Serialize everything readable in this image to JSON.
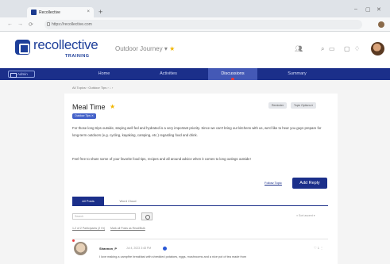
{
  "browser": {
    "tab_title": "Recollective",
    "tab_close": "×",
    "new_tab": "+",
    "url": "https://recollective.com",
    "minimize": "–",
    "maximize": "▢",
    "close": "✕",
    "back": "←",
    "forward": "→",
    "reload": "⟳"
  },
  "header": {
    "logo_text": "recollective",
    "logo_sub": "TRAINING",
    "journey_label": "Outdoor Journey",
    "journey_caret": "▾",
    "journey_star": "★"
  },
  "mainnav": {
    "admin_label": "Admin",
    "items": [
      "Home",
      "Activities",
      "Discussions",
      "Summary"
    ],
    "active_index": 2
  },
  "breadcrumb": "All Topics  ›  Outdoor Tips  ›  ↓  ›",
  "topic": {
    "title": "Meal Time",
    "tag": "Outdoor Tips ✕",
    "reminder_btn": "Reminder",
    "topic_options_btn": "Topic Options ▾",
    "para1": "For those long trips outside, staying well fed and hydrated is a very important priority. Since we can't bring our kitchens with us, we'd like to hear you guys prepare for long-term outdoors (e.g. cycling, kayaking, camping, etc.) regarding food and drink.",
    "para2": "Feel free to share some of your favorite food tips, recipes and all around advice when it comes to long outings outside!",
    "follow_topic": "Follow Topic",
    "add_reply": "Add Reply"
  },
  "posts_tabs": [
    "All Posts",
    "Word Cloud"
  ],
  "search_placeholder": "Search",
  "sort_by": "≡ Sort ascent ▾",
  "meta_links": [
    "1-2 of 2 Participants (2 Hr)",
    "Mark all Posts as Read/Bulk"
  ],
  "post": {
    "author": "Shannon_P",
    "date": "Jul 4, 2023 3:48 PM",
    "likes": "♡ 1 ⋮",
    "text": "I love making a campfire breakfast with shredded potatoes, eggs, mushrooms and a nice pot of tea made from"
  },
  "colors": {
    "brand": "#1b2f8a",
    "accent_star": "#f2b600",
    "nav_active": "#4459b6"
  }
}
